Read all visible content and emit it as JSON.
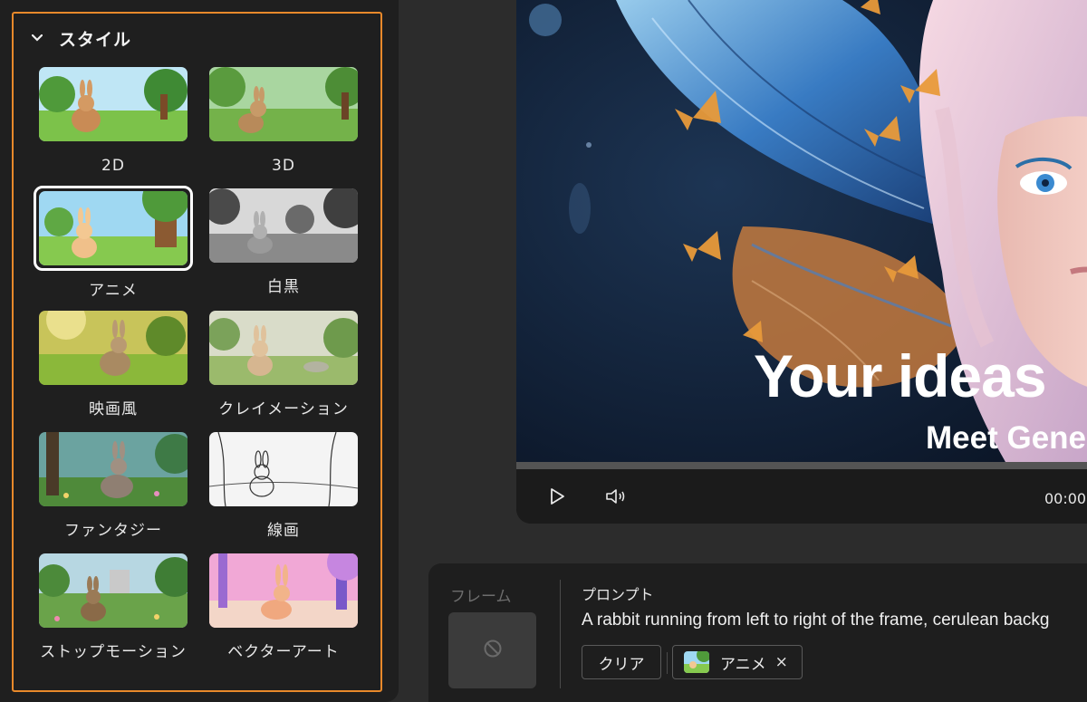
{
  "style_panel": {
    "title": "スタイル",
    "items": [
      {
        "label": "2D",
        "selected": false
      },
      {
        "label": "3D",
        "selected": false
      },
      {
        "label": "アニメ",
        "selected": true
      },
      {
        "label": "白黒",
        "selected": false
      },
      {
        "label": "映画風",
        "selected": false
      },
      {
        "label": "クレイメーション",
        "selected": false
      },
      {
        "label": "ファンタジー",
        "selected": false
      },
      {
        "label": "線画",
        "selected": false
      },
      {
        "label": "ストップモーション",
        "selected": false
      },
      {
        "label": "ベクターアート",
        "selected": false
      }
    ]
  },
  "video": {
    "headline": "Your ideas",
    "subheadline": "Meet Gene",
    "time": "00:00",
    "progress": 0.0
  },
  "prompt_bar": {
    "frame_label": "フレーム",
    "prompt_label": "プロンプト",
    "prompt_text": "A rabbit running from left to right of the frame, cerulean backg",
    "clear_label": "クリア",
    "style_chip_label": "アニメ",
    "style_chip_close": "×"
  },
  "colors": {
    "accent_outline": "#e8892b",
    "panel_bg": "#1f1f1f",
    "page_bg": "#2c2c2c"
  },
  "icons": {
    "collapse": "chevron-down-icon",
    "play": "play-icon",
    "volume": "volume-icon",
    "frame_none": "no-frame-icon",
    "chip_close": "close-icon"
  }
}
